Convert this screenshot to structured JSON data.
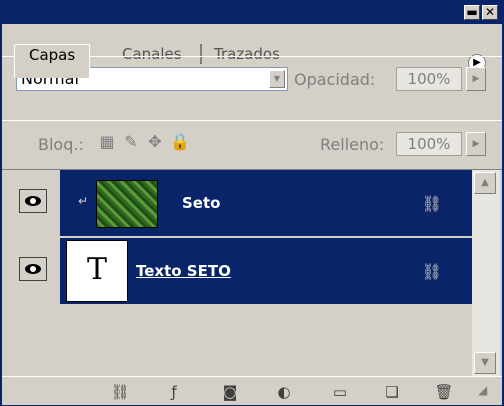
{
  "tabs": [
    {
      "label": "Capas",
      "active": true
    },
    {
      "label": "Canales",
      "active": false
    },
    {
      "label": "Trazados",
      "active": false
    }
  ],
  "blend": {
    "mode": "Normal",
    "opacity_label": "Opacidad:",
    "opacity_value": "100%"
  },
  "lock": {
    "label": "Bloq.:",
    "fill_label": "Relleno:",
    "fill_value": "100%"
  },
  "layers": [
    {
      "name": "Seto",
      "type": "image",
      "clipped": true,
      "selected": true
    },
    {
      "name": "Texto SETO",
      "type": "text",
      "thumb_glyph": "T",
      "selected": true
    }
  ],
  "icons": {
    "eye": "eye-icon",
    "link": "link-icon",
    "clip": "clipping-arrow-icon"
  },
  "colors": {
    "selection": "#0a246a",
    "panel": "#d4d0c8"
  }
}
